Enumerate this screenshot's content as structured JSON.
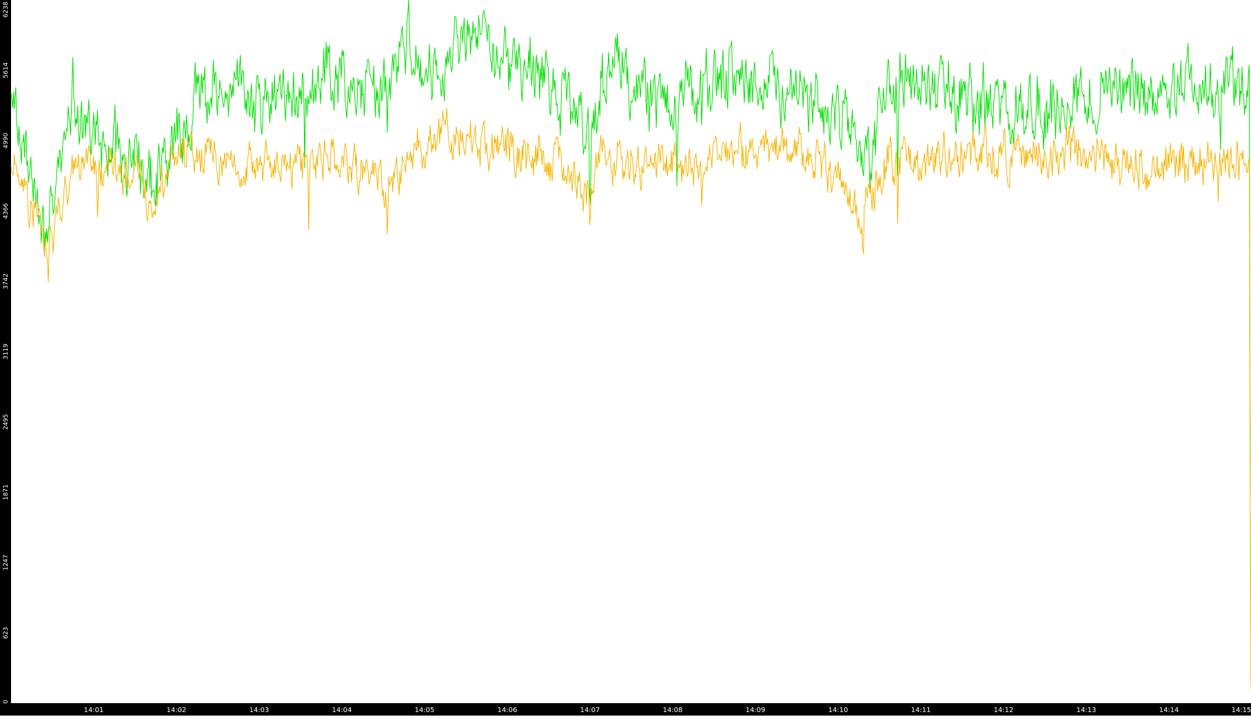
{
  "chart_data": {
    "type": "line",
    "colors": {
      "axis_background": "#000000",
      "tick_label": "#ffffff",
      "plot_background": "#ffffff"
    },
    "y_ticks": [
      "0",
      "623",
      "1247",
      "1871",
      "2495",
      "3119",
      "3742",
      "4366",
      "4990",
      "5614",
      "6238"
    ],
    "ylim": [
      0,
      6238
    ],
    "x_ticks": [
      "14:01",
      "14:02",
      "14:03",
      "14:04",
      "14:05",
      "14:06",
      "14:07",
      "14:08",
      "14:09",
      "14:10",
      "14:11",
      "14:12",
      "14:13",
      "14:14",
      "14:15"
    ],
    "x_range_minutes": [
      0,
      15
    ],
    "grid": false,
    "series": [
      {
        "color": "#00e000",
        "base": [
          [
            0,
            5300
          ],
          [
            0.12,
            5050
          ],
          [
            0.3,
            4500
          ],
          [
            0.45,
            4300
          ],
          [
            0.6,
            4600
          ],
          [
            0.75,
            5450
          ],
          [
            0.9,
            5100
          ],
          [
            1.2,
            4950
          ],
          [
            1.5,
            4850
          ],
          [
            1.7,
            4600
          ],
          [
            1.9,
            4900
          ],
          [
            2.2,
            5300
          ],
          [
            2.6,
            5600
          ],
          [
            3.0,
            5300
          ],
          [
            3.4,
            5400
          ],
          [
            3.8,
            5550
          ],
          [
            4.2,
            5400
          ],
          [
            4.6,
            5500
          ],
          [
            4.8,
            5900
          ],
          [
            5.0,
            5600
          ],
          [
            5.5,
            5900
          ],
          [
            6.0,
            5700
          ],
          [
            6.5,
            5500
          ],
          [
            6.8,
            5300
          ],
          [
            7.0,
            4900
          ],
          [
            7.2,
            5700
          ],
          [
            7.5,
            5500
          ],
          [
            8.0,
            5300
          ],
          [
            8.5,
            5500
          ],
          [
            9.0,
            5550
          ],
          [
            9.5,
            5400
          ],
          [
            10.0,
            5200
          ],
          [
            10.4,
            4800
          ],
          [
            10.6,
            5500
          ],
          [
            11.0,
            5500
          ],
          [
            11.5,
            5400
          ],
          [
            12.0,
            5300
          ],
          [
            12.5,
            5200
          ],
          [
            13.0,
            5400
          ],
          [
            13.5,
            5500
          ],
          [
            14.0,
            5350
          ],
          [
            14.5,
            5500
          ],
          [
            14.97,
            5400
          ]
        ],
        "amplitude": 240,
        "dips": [
          [
            0.4,
            350
          ],
          [
            3.55,
            700
          ],
          [
            4.55,
            550
          ],
          [
            7.0,
            500
          ],
          [
            8.05,
            650
          ],
          [
            8.35,
            500
          ],
          [
            10.3,
            600
          ],
          [
            10.72,
            800
          ],
          [
            14.62,
            500
          ]
        ],
        "end_drop": [
          [
            14.985,
            1300
          ],
          [
            15.0,
            120
          ]
        ]
      },
      {
        "color": "#f5b400",
        "base": [
          [
            0,
            4850
          ],
          [
            0.12,
            4700
          ],
          [
            0.3,
            4250
          ],
          [
            0.5,
            4100
          ],
          [
            0.7,
            4650
          ],
          [
            0.9,
            4800
          ],
          [
            1.2,
            4700
          ],
          [
            1.5,
            4650
          ],
          [
            1.7,
            4450
          ],
          [
            1.9,
            4750
          ],
          [
            2.2,
            4900
          ],
          [
            2.6,
            4850
          ],
          [
            3.0,
            4750
          ],
          [
            3.4,
            4700
          ],
          [
            3.8,
            4850
          ],
          [
            4.2,
            4650
          ],
          [
            4.6,
            4600
          ],
          [
            4.8,
            4800
          ],
          [
            5.0,
            5000
          ],
          [
            5.5,
            5050
          ],
          [
            6.0,
            4950
          ],
          [
            6.5,
            4850
          ],
          [
            6.8,
            4750
          ],
          [
            7.0,
            4500
          ],
          [
            7.2,
            4850
          ],
          [
            7.5,
            4750
          ],
          [
            8.0,
            4800
          ],
          [
            8.5,
            4850
          ],
          [
            9.0,
            4900
          ],
          [
            9.5,
            4900
          ],
          [
            10.0,
            4700
          ],
          [
            10.3,
            4300
          ],
          [
            10.6,
            4800
          ],
          [
            11.0,
            4800
          ],
          [
            11.5,
            4850
          ],
          [
            12.0,
            4850
          ],
          [
            12.5,
            4850
          ],
          [
            13.0,
            4900
          ],
          [
            13.5,
            4850
          ],
          [
            14.0,
            4750
          ],
          [
            14.5,
            4850
          ],
          [
            14.97,
            4800
          ]
        ],
        "amplitude": 170,
        "dips": [
          [
            0.45,
            300
          ],
          [
            1.05,
            450
          ],
          [
            3.6,
            700
          ],
          [
            4.55,
            600
          ],
          [
            7.0,
            350
          ],
          [
            8.35,
            550
          ],
          [
            10.3,
            450
          ],
          [
            10.72,
            500
          ],
          [
            14.6,
            450
          ]
        ],
        "end_drop": [
          [
            14.99,
            200
          ],
          [
            15.0,
            0
          ]
        ]
      }
    ]
  }
}
